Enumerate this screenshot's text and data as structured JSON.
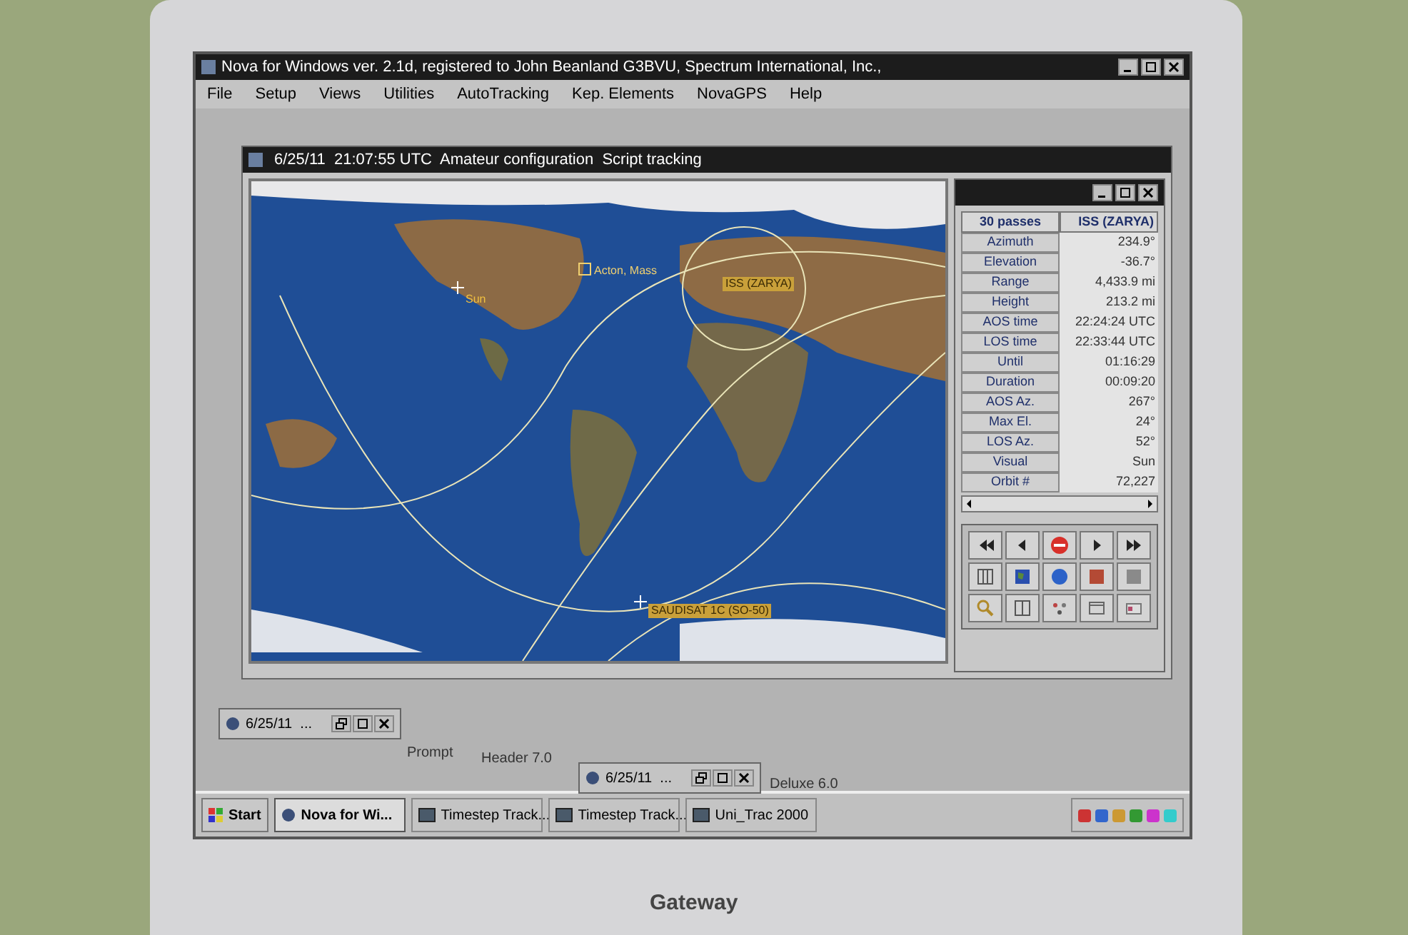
{
  "app_window": {
    "title": "Nova for Windows ver. 2.1d, registered to John Beanland G3BVU, Spectrum International, Inc.,",
    "menu": [
      "File",
      "Setup",
      "Views",
      "Utilities",
      "AutoTracking",
      "Kep. Elements",
      "NovaGPS",
      "Help"
    ]
  },
  "tracking_window": {
    "title": "6/25/11  21:07:55 UTC  Amateur configuration  Script tracking",
    "map_labels": [
      {
        "kind": "observer",
        "text": "Acton, Mass"
      },
      {
        "kind": "sun",
        "text": "Sun"
      },
      {
        "kind": "satellite",
        "text": "ISS (ZARYA)"
      },
      {
        "kind": "satellite",
        "text": "SAUDISAT 1C (SO-50)"
      }
    ],
    "pass_table": {
      "header": [
        "30 passes",
        "ISS (ZARYA)"
      ],
      "rows": [
        {
          "label": "Azimuth",
          "value": "234.9°"
        },
        {
          "label": "Elevation",
          "value": "-36.7°"
        },
        {
          "label": "Range",
          "value": "4,433.9 mi"
        },
        {
          "label": "Height",
          "value": "213.2 mi"
        },
        {
          "label": "AOS time",
          "value": "22:24:24 UTC"
        },
        {
          "label": "LOS time",
          "value": "22:33:44 UTC"
        },
        {
          "label": "Until",
          "value": "01:16:29"
        },
        {
          "label": "Duration",
          "value": "00:09:20"
        },
        {
          "label": "AOS Az.",
          "value": "267°"
        },
        {
          "label": "Max El.",
          "value": "24°"
        },
        {
          "label": "LOS Az.",
          "value": "52°"
        },
        {
          "label": "Visual",
          "value": "Sun"
        },
        {
          "label": "Orbit #",
          "value": "72,227"
        }
      ]
    }
  },
  "minimized_windows": [
    {
      "title": "6/25/11  ..."
    },
    {
      "title": "6/25/11  ..."
    }
  ],
  "desktop_labels": [
    "Prompt",
    "Header 7.0",
    "Deluxe 6.0"
  ],
  "taskbar": {
    "start": "Start",
    "tasks": [
      {
        "label": "Nova for Wi...",
        "selected": true
      },
      {
        "label": "Timestep Track...",
        "selected": false
      },
      {
        "label": "Timestep Track...",
        "selected": false
      },
      {
        "label": "Uni_Trac 2000",
        "selected": false
      }
    ]
  },
  "laptop": {
    "brand": "Gateway"
  }
}
